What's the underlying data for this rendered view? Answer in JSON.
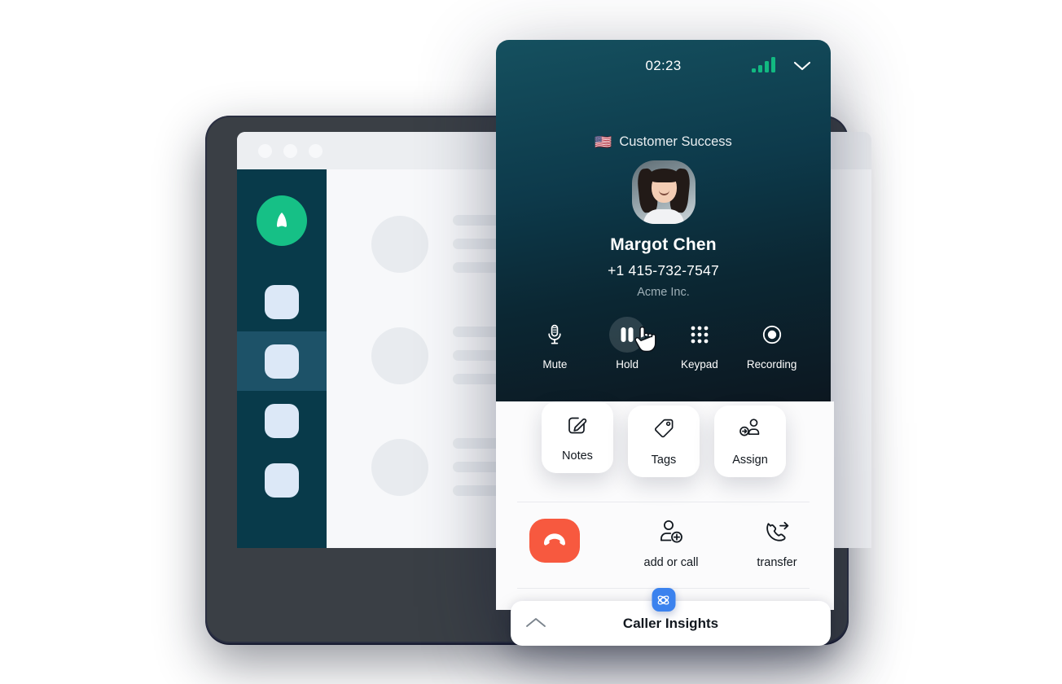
{
  "background_app": {
    "window_dots": [
      "dot-1",
      "dot-2",
      "dot-3"
    ],
    "sidebar": {
      "logo_icon": "aircall-logo-icon",
      "items": [
        {
          "icon": "nav-chip-icon",
          "active": false
        },
        {
          "icon": "nav-chip-icon",
          "active": true
        },
        {
          "icon": "nav-chip-icon",
          "active": false
        },
        {
          "icon": "nav-chip-icon",
          "active": false
        }
      ]
    },
    "content_placeholders": [
      {
        "line_widths": [
          122,
          138,
          122
        ]
      },
      {
        "line_widths": [
          122,
          138,
          122
        ]
      },
      {
        "line_widths": [
          122,
          138,
          122
        ]
      }
    ]
  },
  "call_panel": {
    "topbar": {
      "timer": "02:23",
      "signal_icon": "signal-bars-icon",
      "signal_color": "#12b981",
      "collapse_icon": "chevron-down-icon"
    },
    "queue": {
      "flag_icon": "us-flag-icon",
      "flag": "🇺🇸",
      "name": "Customer Success"
    },
    "contact": {
      "avatar_icon": "contact-avatar",
      "name": "Margot Chen",
      "phone": "+1 415-732-7547",
      "company": "Acme Inc."
    },
    "controls": [
      {
        "label": "Mute",
        "icon": "microphone-icon",
        "active": false
      },
      {
        "label": "Hold",
        "icon": "pause-icon",
        "active": true
      },
      {
        "label": "Keypad",
        "icon": "keypad-grid-icon",
        "active": false
      },
      {
        "label": "Recording",
        "icon": "record-dot-icon",
        "active": false
      }
    ],
    "cursor_icon": "hand-pointer-cursor",
    "quick_cards": [
      {
        "id": "card-notes",
        "label": "Notes",
        "icon": "note-pencil-icon"
      },
      {
        "id": "card-tags",
        "label": "Tags",
        "icon": "tag-icon"
      },
      {
        "id": "card-assign",
        "label": "Assign",
        "icon": "assign-user-icon"
      }
    ],
    "actions": {
      "hangup": {
        "label": "",
        "icon": "hangup-phone-icon",
        "color": "#f7593f"
      },
      "items": [
        {
          "id": "act-add",
          "label": "add or call",
          "icon": "add-person-icon"
        },
        {
          "id": "act-transfer",
          "label": "transfer",
          "icon": "transfer-call-icon"
        }
      ]
    },
    "insights": {
      "badge_icon": "insights-atom-icon",
      "badge_color": "#3b82ee",
      "expand_icon": "chevron-up-icon",
      "label": "Caller Insights"
    }
  }
}
